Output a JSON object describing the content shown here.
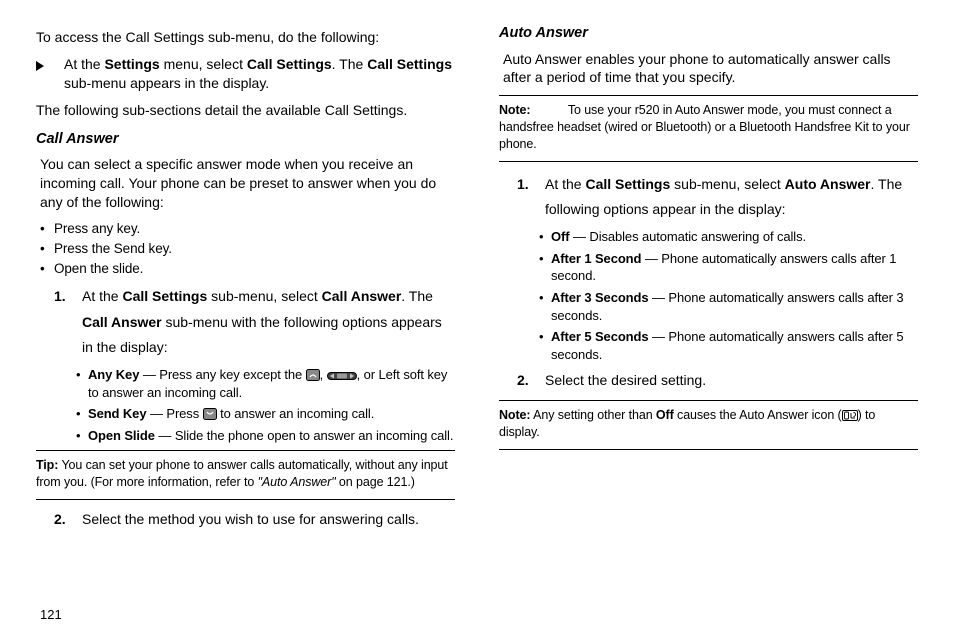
{
  "left": {
    "intro": "To access the Call Settings sub-menu, do the following:",
    "step_prefix": "At the ",
    "step_b1": "Settings",
    "step_mid1": " menu, select ",
    "step_b2": "Call Settings",
    "step_mid2": ". The ",
    "step_b3": "Call Settings",
    "step_end": " sub-menu appears in the display.",
    "follow": "The following sub-sections detail the available Call Settings.",
    "h1": "Call Answer",
    "p1": "You can select a specific answer mode when you receive an incoming call. Your phone can be preset to answer when you do any of the following:",
    "b1": "Press any key.",
    "b2": "Press the Send key.",
    "b3": "Open the slide.",
    "n1_a": "At the ",
    "n1_b1": "Call Settings",
    "n1_b": " sub-menu, select ",
    "n1_b2": "Call Answer",
    "n1_c": ". The ",
    "n1_b3": "Call Answer",
    "n1_d": " sub-menu with the following options appears in the display:",
    "sb1_b": "Any Key",
    "sb1_t1": " — Press any key except the ",
    "sb1_t2": ", ",
    "sb1_t3": ", or Left soft key to answer an incoming call.",
    "sb2_b": "Send Key",
    "sb2_t1": " — Press ",
    "sb2_t2": " to answer an incoming call.",
    "sb3_b": "Open Slide",
    "sb3_t": " — Slide the phone open to answer an incoming call.",
    "tip_lbl": "Tip:",
    "tip_t1": "You can set your phone to answer calls automatically, without any input from you. (For more information, refer to ",
    "tip_em": "\"Auto Answer\"",
    "tip_t2": "  on page 121.)",
    "n2": "Select the method you wish to use for answering calls."
  },
  "right": {
    "h1": "Auto Answer",
    "p1": "Auto Answer enables your phone to automatically answer calls after a period of time that you specify.",
    "note1_lbl": "Note:",
    "note1_t": "To use your r520 in Auto Answer mode, you must connect a handsfree headset (wired or Bluetooth) or a Bluetooth Handsfree Kit to your phone.",
    "n1_a": "At the ",
    "n1_b1": "Call Settings",
    "n1_b": " sub-menu, select ",
    "n1_b2": "Auto Answer",
    "n1_c": ". The following options appear in the display:",
    "sb1_b": "Off",
    "sb1_t": " — Disables automatic answering of calls.",
    "sb2_b": "After 1 Second",
    "sb2_t": " — Phone automatically answers calls after 1 second.",
    "sb3_b": "After 3 Seconds",
    "sb3_t": " — Phone automatically answers calls after 3 seconds.",
    "sb4_b": "After 5 Seconds",
    "sb4_t": " — Phone automatically answers calls after 5 seconds.",
    "n2": "Select the desired setting.",
    "note2_lbl": "Note:",
    "note2_t1": "Any setting other than ",
    "note2_b": "Off",
    "note2_t2": " causes the Auto Answer icon (",
    "note2_t3": ") to display."
  },
  "pagenum": "121"
}
